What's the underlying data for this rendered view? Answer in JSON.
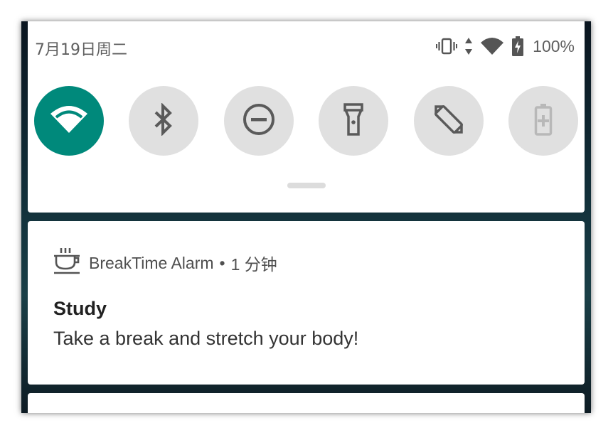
{
  "status_bar": {
    "date": "7月19日周二",
    "battery_percent": "100%",
    "icons": [
      "vibrate-icon",
      "data-arrows-icon",
      "wifi-icon",
      "battery-charging-icon"
    ]
  },
  "quick_settings": {
    "tiles": [
      {
        "name": "wifi",
        "icon": "wifi-icon",
        "state": "on",
        "color": "#00897b"
      },
      {
        "name": "bluetooth",
        "icon": "bluetooth-icon",
        "state": "off"
      },
      {
        "name": "do-not-disturb",
        "icon": "dnd-icon",
        "state": "off"
      },
      {
        "name": "flashlight",
        "icon": "flashlight-icon",
        "state": "off"
      },
      {
        "name": "auto-rotate",
        "icon": "rotate-icon",
        "state": "off"
      },
      {
        "name": "battery-saver",
        "icon": "battery-saver-icon",
        "state": "unavailable"
      }
    ]
  },
  "notification": {
    "app_icon": "coffee-cup-icon",
    "app_name": "BreakTime Alarm",
    "separator": "•",
    "time": "1 分钟",
    "title": "Study",
    "text": "Take a break and stretch your body!"
  },
  "colors": {
    "accent": "#00897b",
    "tile_inactive": "#e0e0e0",
    "panel": "#ffffff"
  }
}
